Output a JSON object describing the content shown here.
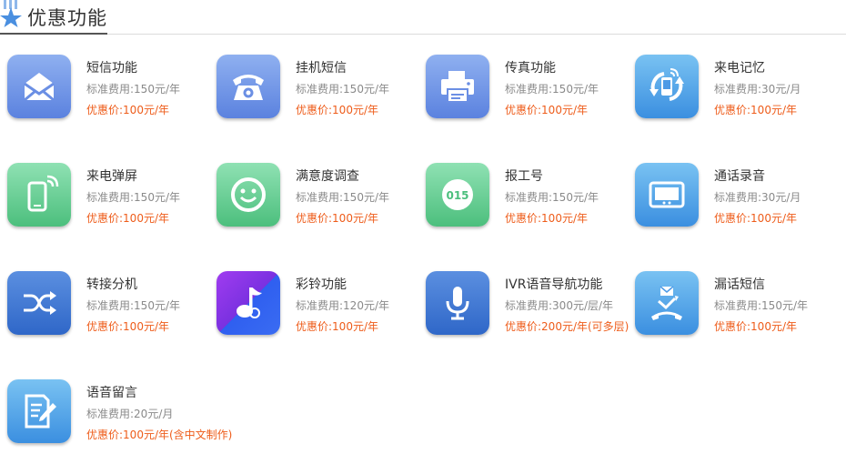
{
  "header": {
    "title": "优惠功能"
  },
  "features": [
    {
      "name": "短信功能",
      "standard": "标准费用:150元/年",
      "promo": "优惠价:100元/年",
      "icon": "envelope-icon",
      "color": "blue"
    },
    {
      "name": "挂机短信",
      "standard": "标准费用:150元/年",
      "promo": "优惠价:100元/年",
      "icon": "telephone-icon",
      "color": "blue"
    },
    {
      "name": "传真功能",
      "standard": "标准费用:150元/年",
      "promo": "优惠价:100元/年",
      "icon": "printer-icon",
      "color": "blue"
    },
    {
      "name": "来电记忆",
      "standard": "标准费用:30元/月",
      "promo": "优惠价:100元/年",
      "icon": "phone-refresh-icon",
      "color": "sky"
    },
    {
      "name": "来电弹屏",
      "standard": "标准费用:150元/年",
      "promo": "优惠价:100元/年",
      "icon": "mobile-signal-icon",
      "color": "green"
    },
    {
      "name": "满意度调查",
      "standard": "标准费用:150元/年",
      "promo": "优惠价:100元/年",
      "icon": "smiley-icon",
      "color": "green"
    },
    {
      "name": "报工号",
      "standard": "标准费用:150元/年",
      "promo": "优惠价:100元/年",
      "icon": "number-badge-icon",
      "color": "green",
      "badge": "015"
    },
    {
      "name": "通话录音",
      "standard": "标准费用:30元/月",
      "promo": "优惠价:100元/年",
      "icon": "recorder-screen-icon",
      "color": "sky"
    },
    {
      "name": "转接分机",
      "standard": "标准费用:150元/年",
      "promo": "优惠价:100元/年",
      "icon": "shuffle-icon",
      "color": "navy"
    },
    {
      "name": "彩铃功能",
      "standard": "标准费用:120元/年",
      "promo": "优惠价:100元/年",
      "icon": "music-note-icon",
      "color": "purple"
    },
    {
      "name": "IVR语音导航功能",
      "standard": "标准费用:300元/层/年",
      "promo": "优惠价:200元/年(可多层)",
      "icon": "microphone-icon",
      "color": "navy"
    },
    {
      "name": "漏话短信",
      "standard": "标准费用:150元/年",
      "promo": "优惠价:100元/年",
      "icon": "missed-call-icon",
      "color": "sky"
    },
    {
      "name": "语音留言",
      "standard": "标准费用:20元/月",
      "promo": "优惠价:100元/年(含中文制作)",
      "icon": "note-edit-icon",
      "color": "sky"
    }
  ]
}
